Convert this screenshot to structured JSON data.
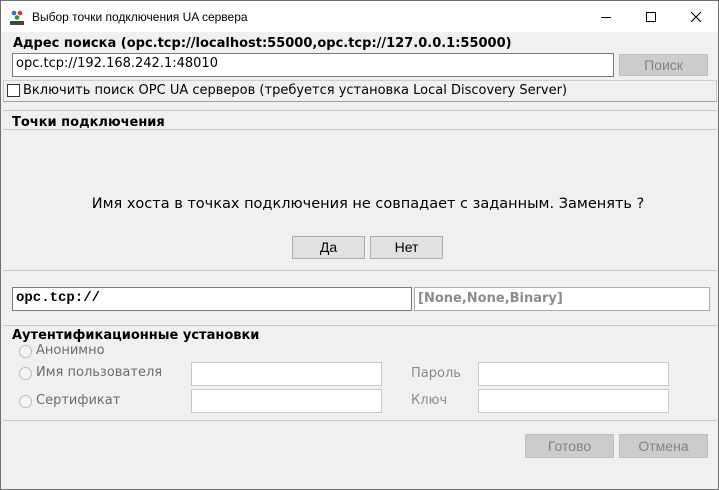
{
  "window": {
    "title": "Выбор точки подключения UA сервера",
    "icon": "opc-app-icon"
  },
  "search": {
    "title": "Адрес поиска (opc.tcp://localhost:55000,opc.tcp://127.0.0.1:55000)",
    "value": "opc.tcp://192.168.242.1:48010",
    "button_label": "Поиск"
  },
  "discovery": {
    "checkbox_label": "Включить поиск OPC UA серверов (требуется установка Local Discovery Server)",
    "checked": false
  },
  "endpoints": {
    "title": "Точки подключения"
  },
  "prompt": {
    "message": "Имя хоста в точках подключения не совпадает с заданным. Заменять ?",
    "yes_label": "Да",
    "no_label": "Нет"
  },
  "connection": {
    "url": "opc.tcp://",
    "security": "[None,None,Binary]"
  },
  "auth": {
    "title": "Аутентификационные установки",
    "anonymous_label": "Анонимно",
    "username_label": "Имя пользователя",
    "password_label": "Пароль",
    "certificate_label": "Сертификат",
    "key_label": "Ключ"
  },
  "footer": {
    "done_label": "Готово",
    "cancel_label": "Отмена"
  },
  "colors": {
    "window_bg": "#f0f0f0",
    "disabled_button_bg": "#cccccc",
    "disabled_text": "#838383"
  }
}
